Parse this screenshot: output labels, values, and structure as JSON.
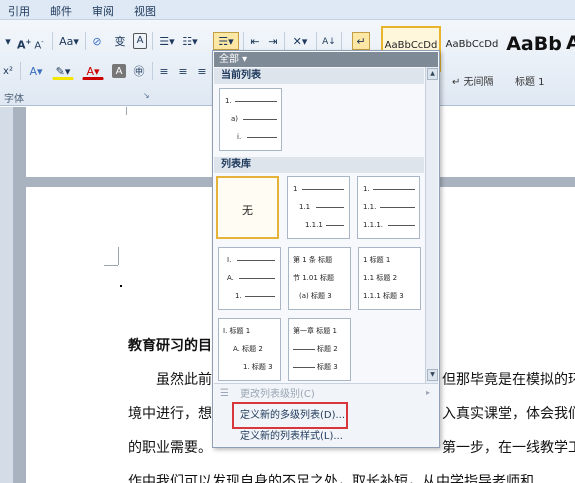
{
  "menubar": {
    "items": [
      "引用",
      "邮件",
      "审阅",
      "视图"
    ]
  },
  "ribbon": {
    "group_label": "字体",
    "styles": [
      {
        "sample": "AaBbCcDd",
        "name": ""
      },
      {
        "sample": "AaBbCcDd",
        "name": "↵ 无间隔"
      },
      {
        "sample": "AaBb",
        "name": "标题 1"
      }
    ],
    "style_partial": "A",
    "icons": [
      "font-grow-icon",
      "font-shrink-icon",
      "change-case-icon",
      "phonetic-guide-icon",
      "char-border-icon",
      "bullets-icon",
      "numbering-icon",
      "multilevel-list-icon",
      "decrease-indent-icon",
      "increase-indent-icon",
      "chinese-layout-icon",
      "sort-icon",
      "show-marks-icon",
      "superscript-icon",
      "text-effects-icon",
      "highlight-icon",
      "font-color-icon",
      "char-shading-icon",
      "enclose-char-icon",
      "align-left-icon",
      "center-icon"
    ]
  },
  "dropdown": {
    "filter": "全部 ▾",
    "current_header": "当前列表",
    "library_header": "列表库",
    "current_tile": [
      "1.",
      "a)",
      "i."
    ],
    "none_label": "无",
    "tiles": [
      [
        "1",
        "1.1",
        "1.1.1"
      ],
      [
        "1.",
        "1.1.",
        "1.1.1."
      ],
      [
        "I.",
        "A.",
        "1."
      ],
      [
        "第 1 条 标题",
        "节 1.01 标题",
        "(a) 标题 3"
      ],
      [
        "1 标题 1",
        "1.1 标题 2",
        "1.1.1 标题 3"
      ],
      [
        "I. 标题 1",
        "A. 标题 2",
        "1. 标题 3"
      ],
      [
        "第一章 标题 1",
        "标题 2",
        "标题 3"
      ]
    ],
    "commands": {
      "change_level": "更改列表级别(C)",
      "define_multilevel": "定义新的多级列表(D)...",
      "define_style": "定义新的列表样式(L)..."
    }
  },
  "document": {
    "heading_partial": "教育研习的目",
    "line1_left": "虽然此前",
    "line1_right": "但那毕竟是在模拟的环",
    "line2_left": "境中进行，想",
    "line2_right": "入真实课堂，体会我们",
    "line3_left": "的职业需要。",
    "line3_right": "第一步，在一线教学工",
    "line4": "作中我们可以发现自身的不足之处，取长补短，从中学指导老师和"
  }
}
